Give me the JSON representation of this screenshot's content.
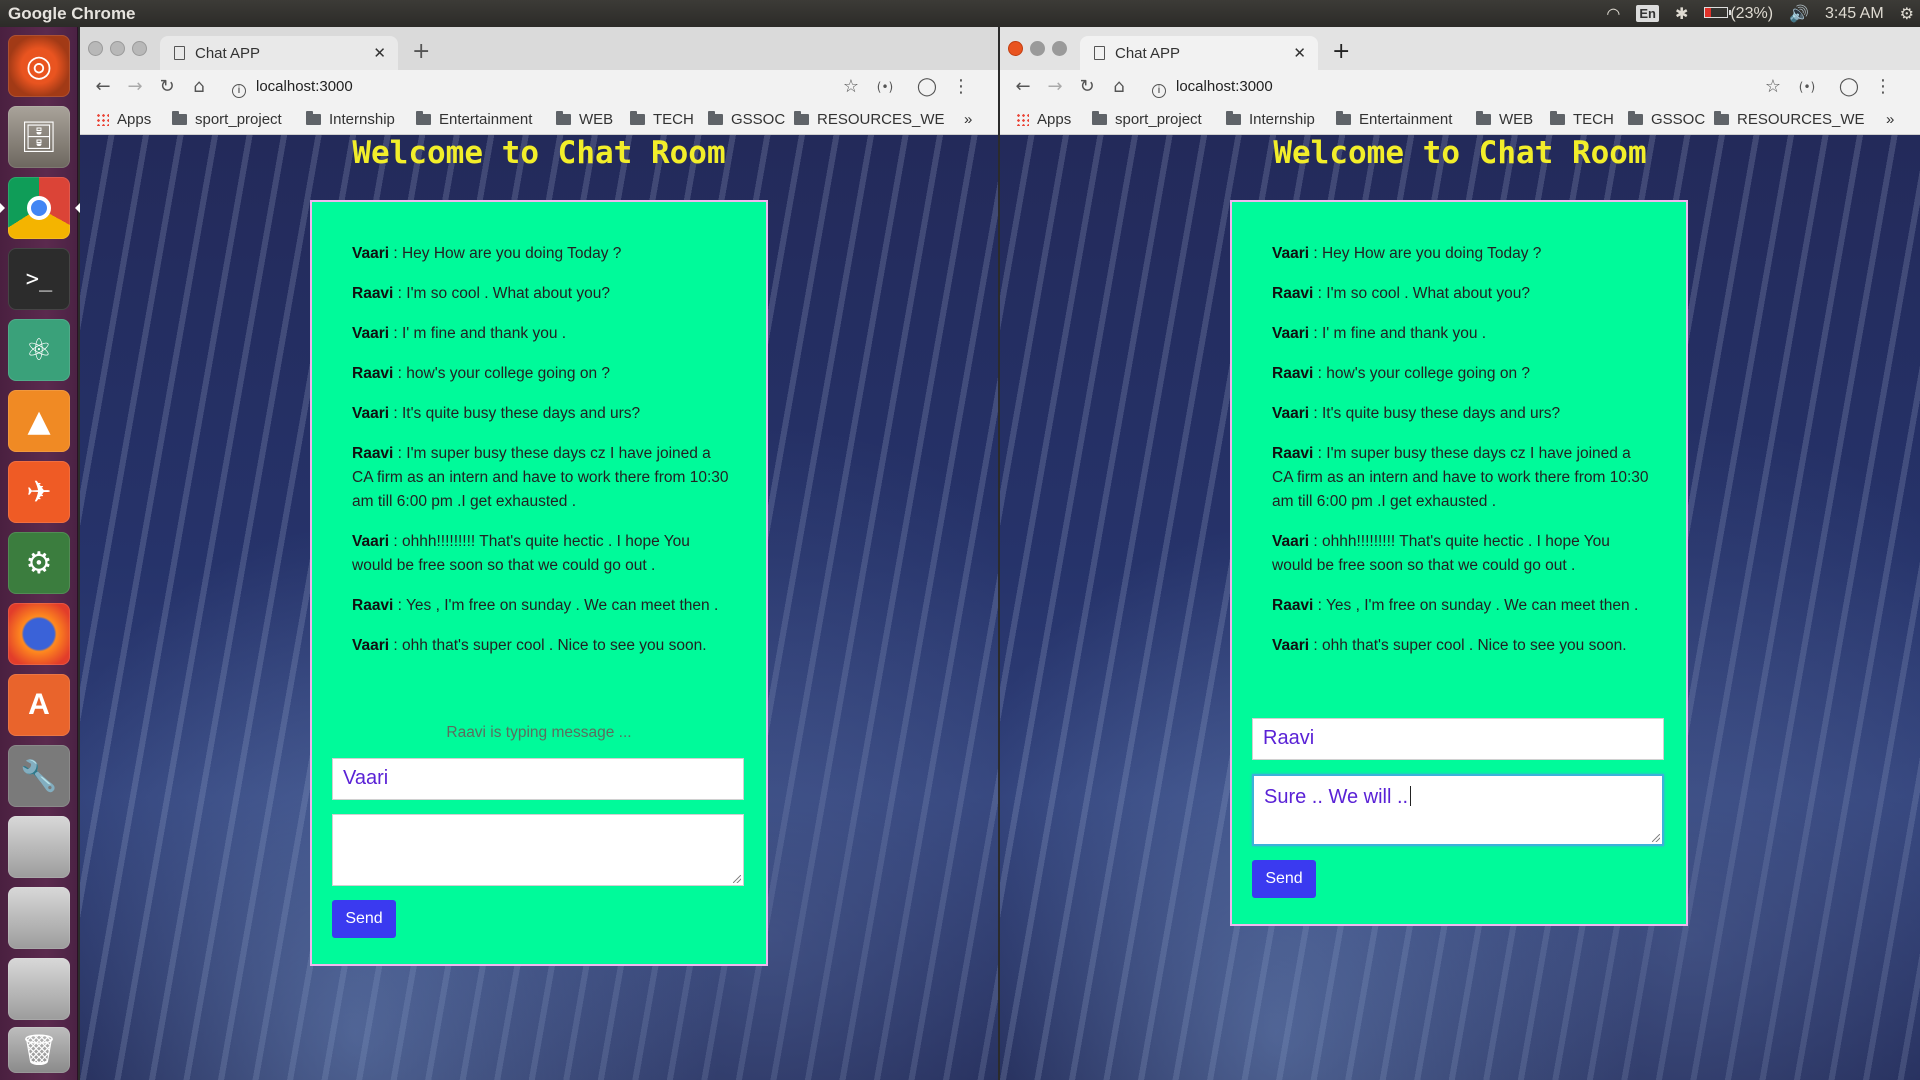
{
  "system": {
    "app_title": "Google Chrome",
    "lang": "En",
    "battery": "(23%)",
    "time": "3:45 AM"
  },
  "launcher": {
    "items": [
      "ubuntu-dash",
      "files",
      "chrome",
      "terminal",
      "atom",
      "vlc",
      "postman",
      "android-studio",
      "firefox",
      "software-center",
      "settings",
      "disk-1",
      "disk-2",
      "disk-3",
      "trash"
    ]
  },
  "left_window": {
    "tab_title": "Chat APP",
    "url": "localhost:3000",
    "bookmarks": [
      "Apps",
      "sport_project",
      "Internship",
      "Entertainment",
      "WEB",
      "TECH",
      "GSSOC",
      "RESOURCES_WE"
    ],
    "page_title": "Welcome to Chat Room",
    "messages": [
      {
        "sender": "Vaari",
        "text": " : Hey How are you doing Today ?"
      },
      {
        "sender": "Raavi",
        "text": " : I'm so cool . What about you?"
      },
      {
        "sender": "Vaari",
        "text": " : I' m fine and thank you ."
      },
      {
        "sender": "Raavi",
        "text": " : how's your college going on ?"
      },
      {
        "sender": "Vaari",
        "text": " : It's quite busy these days and urs?"
      },
      {
        "sender": "Raavi",
        "text": " : I'm super busy these days cz I have joined a CA firm as an intern and have to work there from 10:30 am till 6:00 pm .I get exhausted ."
      },
      {
        "sender": "Vaari",
        "text": " : ohhh!!!!!!!!! That's quite hectic . I hope You would be free soon so that we could go out ."
      },
      {
        "sender": "Raavi",
        "text": " : Yes , I'm free on sunday . We can meet then ."
      },
      {
        "sender": "Vaari",
        "text": " : ohh that's super cool . Nice to see you soon."
      }
    ],
    "typing_status": "Raavi is typing message ...",
    "name_value": "Vaari",
    "message_value": "",
    "send_label": "Send"
  },
  "right_window": {
    "tab_title": "Chat APP",
    "url": "localhost:3000",
    "bookmarks": [
      "Apps",
      "sport_project",
      "Internship",
      "Entertainment",
      "WEB",
      "TECH",
      "GSSOC",
      "RESOURCES_WE"
    ],
    "page_title": "Welcome to Chat Room",
    "messages": [
      {
        "sender": "Vaari",
        "text": " : Hey How are you doing Today ?"
      },
      {
        "sender": "Raavi",
        "text": " : I'm so cool . What about you?"
      },
      {
        "sender": "Vaari",
        "text": " : I' m fine and thank you ."
      },
      {
        "sender": "Raavi",
        "text": " : how's your college going on ?"
      },
      {
        "sender": "Vaari",
        "text": " : It's quite busy these days and urs?"
      },
      {
        "sender": "Raavi",
        "text": " : I'm super busy these days cz I have joined a CA firm as an intern and have to work there from 10:30 am till 6:00 pm .I get exhausted ."
      },
      {
        "sender": "Vaari",
        "text": " : ohhh!!!!!!!!! That's quite hectic . I hope You would be free soon so that we could go out ."
      },
      {
        "sender": "Raavi",
        "text": " : Yes , I'm free on sunday . We can meet then ."
      },
      {
        "sender": "Vaari",
        "text": " : ohh that's super cool . Nice to see you soon."
      }
    ],
    "name_value": "Raavi",
    "message_value": "Sure .. We will ..",
    "send_label": "Send"
  },
  "colors": {
    "card_bg": "#00fa9a",
    "title_yellow": "#f2ee2a",
    "send_button": "#3a3af0",
    "input_text": "#5a22d6"
  }
}
